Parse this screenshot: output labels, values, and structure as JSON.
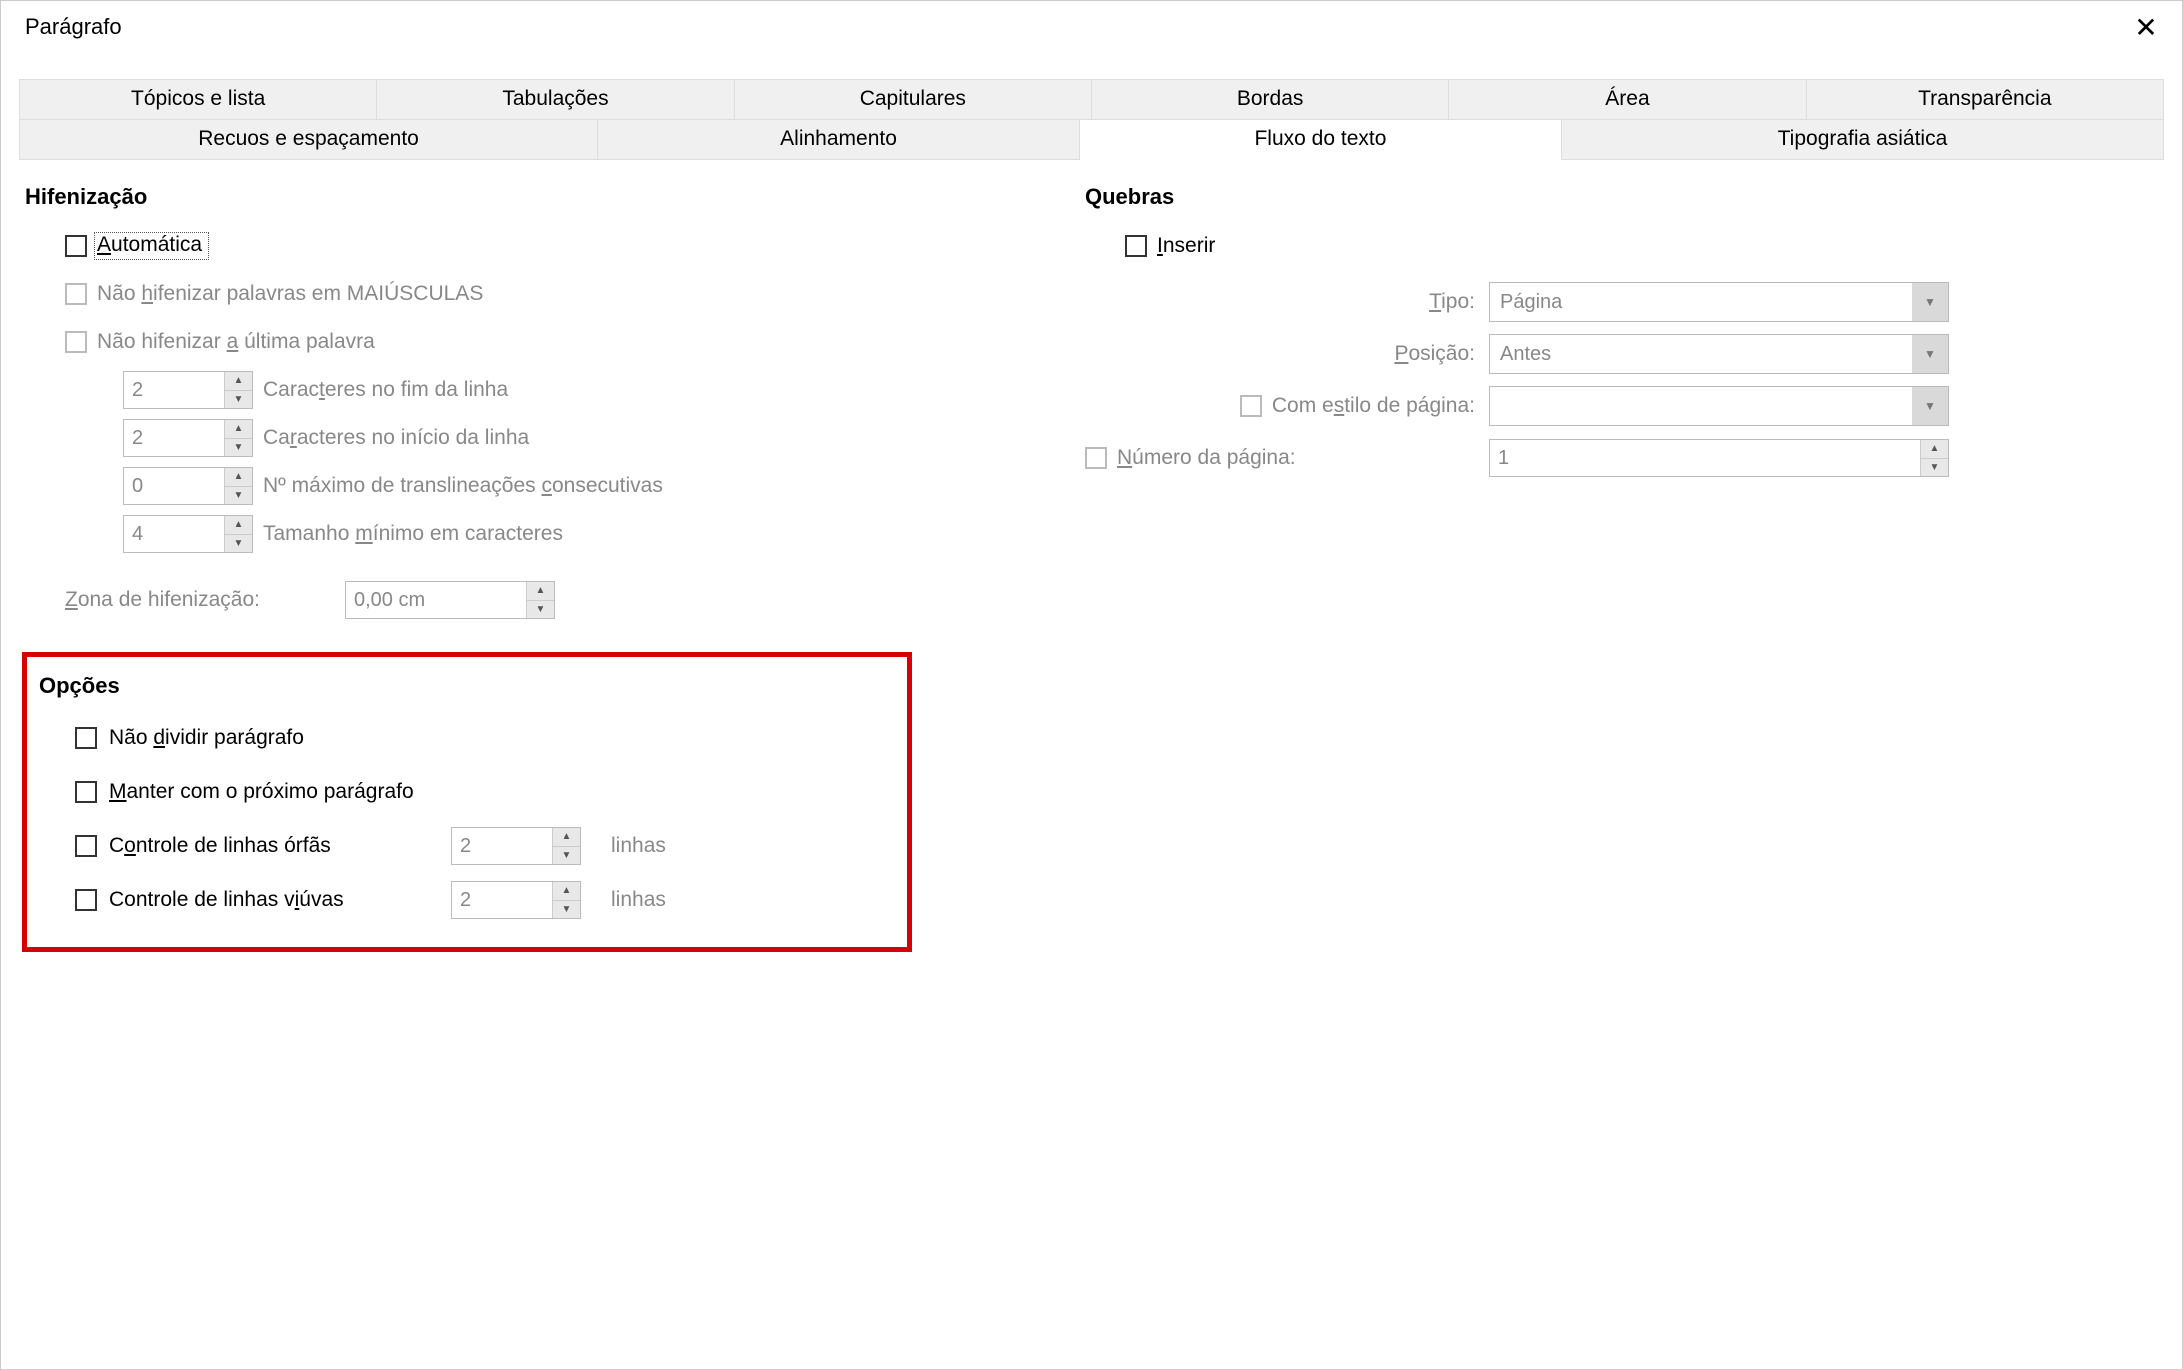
{
  "window_title": "Parágrafo",
  "tabs_row1": [
    {
      "label": "Tópicos e lista"
    },
    {
      "label": "Tabulações"
    },
    {
      "label": "Capitulares"
    },
    {
      "label": "Bordas"
    },
    {
      "label": "Área"
    },
    {
      "label": "Transparência"
    }
  ],
  "tabs_row2": [
    {
      "label": "Recuos e espaçamento"
    },
    {
      "label": "Alinhamento"
    },
    {
      "label": "Fluxo do texto",
      "active": true
    },
    {
      "label": "Tipografia asiática"
    }
  ],
  "hyphenation": {
    "title": "Hifenização",
    "automatic": "Automática",
    "no_caps": "Não hifenizar palavras em MAIÚSCULAS",
    "no_last": "Não hifenizar a última palavra",
    "end_chars_value": "2",
    "end_chars_label": "Caracteres no fim da linha",
    "start_chars_value": "2",
    "start_chars_label": "Caracteres no início da linha",
    "max_consec_value": "0",
    "max_consec_label": "Nº máximo de translineações consecutivas",
    "min_len_value": "4",
    "min_len_label": "Tamanho mínimo em caracteres",
    "zone_label": "Zona de hifenização:",
    "zone_value": "0,00 cm"
  },
  "breaks": {
    "title": "Quebras",
    "insert": "Inserir",
    "type_label": "Tipo:",
    "type_value": "Página",
    "position_label": "Posição:",
    "position_value": "Antes",
    "with_style_label": "Com estilo de página:",
    "with_style_value": "",
    "page_number_label": "Número da página:",
    "page_number_value": "1"
  },
  "options": {
    "title": "Opções",
    "no_split": "Não dividir parágrafo",
    "keep_next": "Manter com o próximo parágrafo",
    "orphan_label": "Controle de linhas órfãs",
    "orphan_value": "2",
    "widow_label": "Controle de linhas viúvas",
    "widow_value": "2",
    "lines_suffix": "linhas"
  }
}
